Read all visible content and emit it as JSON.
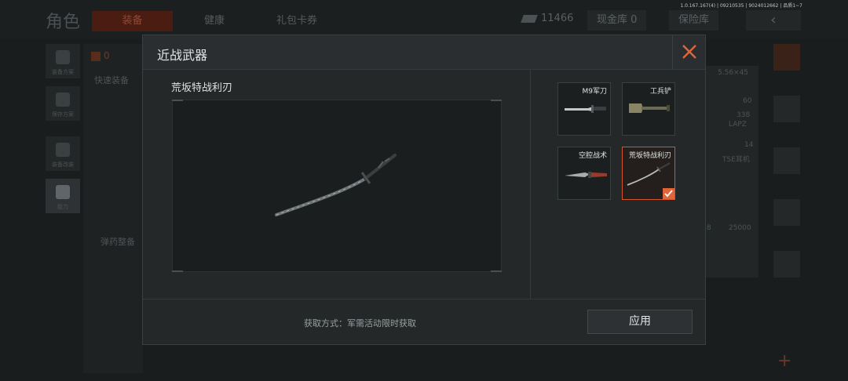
{
  "background": {
    "title": "角色",
    "tabs": [
      "装备",
      "健康",
      "礼包卡券"
    ],
    "currency_value": "11466",
    "cash_vault_label": "现金库 0",
    "insurance_label": "保险库",
    "version": "1.0.167.167(4) | 09210535 | 9024012662 | 品质1~7",
    "left_buttons": [
      "装备方案",
      "保存方案",
      "装备改装",
      "能力"
    ],
    "quick_equip": "快速装备",
    "ammo_label": "弹药整备",
    "right_cells": [
      "5.56×45",
      "60",
      "338",
      "LAPZ",
      "14",
      "TSE耳机",
      "25000",
      "8"
    ],
    "count_badge": "0"
  },
  "dialog": {
    "title": "近战武器",
    "selected_weapon_name": "荒坂特战利刃",
    "items": [
      {
        "label": "M9军刀",
        "icon": "bayonet-icon",
        "selected": false
      },
      {
        "label": "工兵铲",
        "icon": "shovel-icon",
        "selected": false
      },
      {
        "label": "空腔战术",
        "icon": "tactical-knife-icon",
        "selected": false
      },
      {
        "label": "荒坂特战利刃",
        "icon": "katana-icon",
        "selected": true
      }
    ],
    "source_text": "获取方式：军需活动限时获取",
    "apply_label": "应用",
    "colors": {
      "accent": "#e0663a",
      "panel": "#242829",
      "selected_border": "#d4552a"
    }
  }
}
